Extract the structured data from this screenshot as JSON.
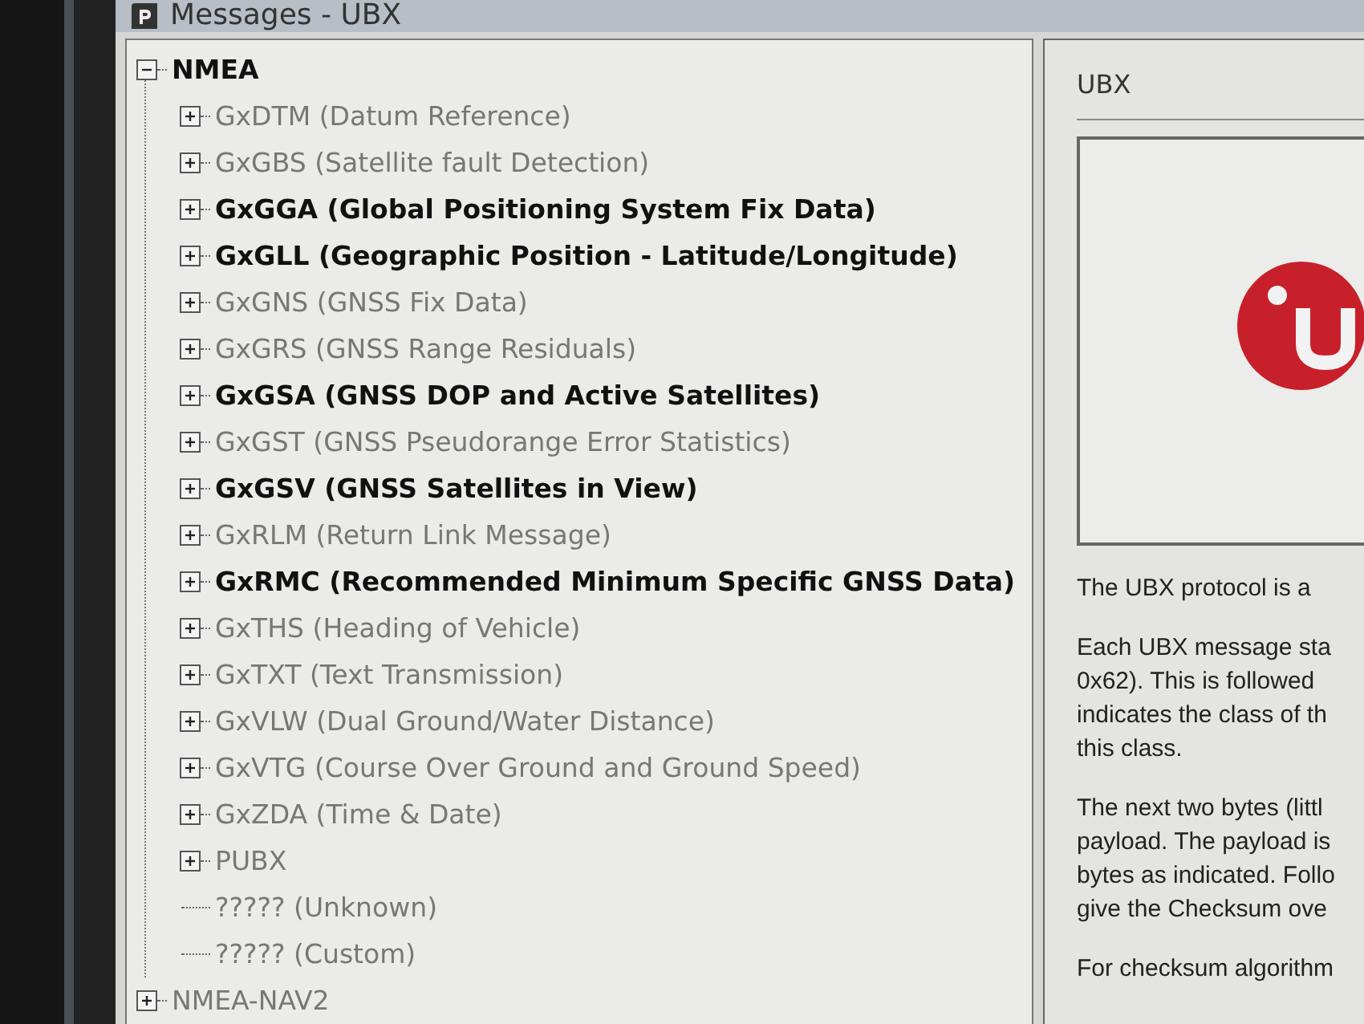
{
  "window": {
    "title": "Messages - UBX"
  },
  "tree": [
    {
      "label": "NMEA",
      "kind": "node",
      "expanded": true,
      "enabled": true,
      "children": [
        {
          "label": "GxDTM (Datum Reference)",
          "kind": "node",
          "expanded": false,
          "enabled": false
        },
        {
          "label": "GxGBS (Satellite fault Detection)",
          "kind": "node",
          "expanded": false,
          "enabled": false
        },
        {
          "label": "GxGGA (Global Positioning System Fix Data)",
          "kind": "node",
          "expanded": false,
          "enabled": true
        },
        {
          "label": "GxGLL (Geographic Position - Latitude/Longitude)",
          "kind": "node",
          "expanded": false,
          "enabled": true
        },
        {
          "label": "GxGNS (GNSS Fix Data)",
          "kind": "node",
          "expanded": false,
          "enabled": false
        },
        {
          "label": "GxGRS (GNSS Range Residuals)",
          "kind": "node",
          "expanded": false,
          "enabled": false
        },
        {
          "label": "GxGSA (GNSS DOP and Active Satellites)",
          "kind": "node",
          "expanded": false,
          "enabled": true
        },
        {
          "label": "GxGST (GNSS Pseudorange Error Statistics)",
          "kind": "node",
          "expanded": false,
          "enabled": false
        },
        {
          "label": "GxGSV (GNSS Satellites in View)",
          "kind": "node",
          "expanded": false,
          "enabled": true
        },
        {
          "label": "GxRLM (Return Link Message)",
          "kind": "node",
          "expanded": false,
          "enabled": false
        },
        {
          "label": "GxRMC (Recommended Minimum Specific GNSS Data)",
          "kind": "node",
          "expanded": false,
          "enabled": true
        },
        {
          "label": "GxTHS (Heading of Vehicle)",
          "kind": "node",
          "expanded": false,
          "enabled": false
        },
        {
          "label": "GxTXT (Text Transmission)",
          "kind": "node",
          "expanded": false,
          "enabled": false
        },
        {
          "label": "GxVLW (Dual Ground/Water Distance)",
          "kind": "node",
          "expanded": false,
          "enabled": false
        },
        {
          "label": "GxVTG (Course Over Ground and Ground Speed)",
          "kind": "node",
          "expanded": false,
          "enabled": false
        },
        {
          "label": "GxZDA (Time & Date)",
          "kind": "node",
          "expanded": false,
          "enabled": false
        },
        {
          "label": "PUBX",
          "kind": "node",
          "expanded": false,
          "enabled": false
        },
        {
          "label": "????? (Unknown)",
          "kind": "leaf",
          "enabled": false
        },
        {
          "label": "????? (Custom)",
          "kind": "leaf",
          "enabled": false
        }
      ]
    },
    {
      "label": "NMEA-NAV2",
      "kind": "node",
      "expanded": false,
      "enabled": false
    }
  ],
  "detail": {
    "heading": "UBX",
    "paragraphs": [
      [
        "The UBX protocol is a"
      ],
      [
        "Each UBX message sta",
        "0x62). This is followed",
        "indicates the class of th",
        "this class."
      ],
      [
        "The next two bytes (littl",
        "payload. The payload is",
        "bytes as indicated. Follo",
        "give the Checksum ove"
      ],
      [
        "For checksum algorithm"
      ]
    ]
  }
}
